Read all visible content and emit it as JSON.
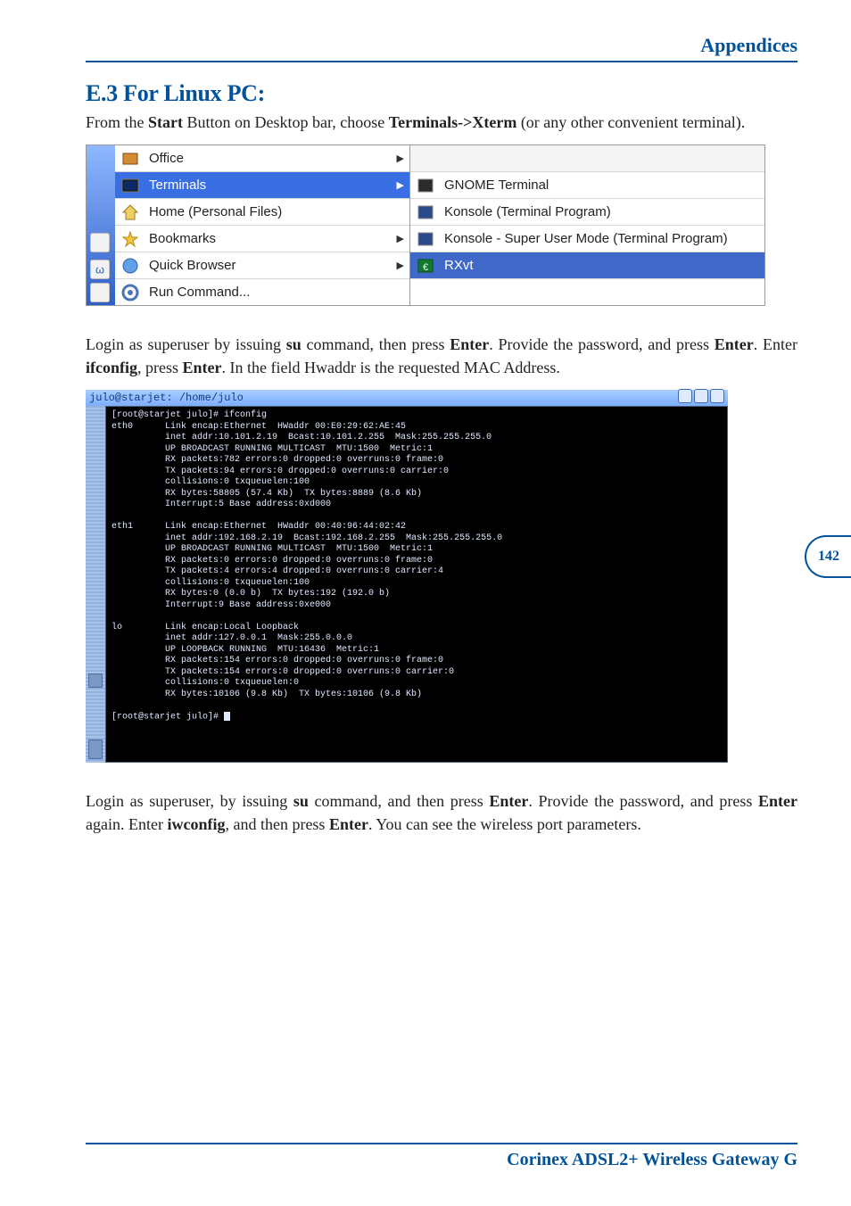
{
  "header": {
    "section": "Appendices"
  },
  "subsection": {
    "title": "E.3 For Linux PC:"
  },
  "intro": {
    "pre": "From the ",
    "b1": "Start",
    "mid1": " Button on Desktop bar, choose ",
    "b2": "Terminals->Xterm",
    "post": " (or any other convenient terminal)."
  },
  "menu": {
    "left": [
      {
        "label": "Office",
        "icon": "office-icon",
        "arrow": true
      },
      {
        "label": "Terminals",
        "icon": "terminal-icon",
        "arrow": true,
        "selected": true
      },
      {
        "label": "Home (Personal Files)",
        "icon": "home-icon",
        "arrow": false
      },
      {
        "label": "Bookmarks",
        "icon": "bookmark-icon",
        "arrow": true
      },
      {
        "label": "Quick Browser",
        "icon": "browser-icon",
        "arrow": true
      },
      {
        "label": "Run Command...",
        "icon": "run-icon",
        "arrow": false
      }
    ],
    "right": [
      {
        "label": "GNOME Terminal",
        "icon": "gnome-terminal-icon"
      },
      {
        "label": "Konsole (Terminal Program)",
        "icon": "konsole-icon"
      },
      {
        "label": "Konsole - Super User Mode (Terminal Program)",
        "icon": "konsole-su-icon"
      },
      {
        "label": "RXvt",
        "icon": "rxvt-icon",
        "selected": true
      }
    ]
  },
  "para2": {
    "t1": "Login as superuser by issuing ",
    "b_su": "su",
    "t2": " command, then press ",
    "b_enter1": "Enter",
    "t3": ". Provide the password, and press ",
    "b_enter2": "Enter",
    "t4": ". Enter ",
    "b_ifconfig": "ifconfig",
    "t5": ", press ",
    "b_enter3": "Enter",
    "t6": ". In the field Hwaddr is the requested MAC Address."
  },
  "terminal": {
    "title": "julo@starjet: /home/julo",
    "lines": "[root@starjet julo]# ifconfig\neth0      Link encap:Ethernet  HWaddr 00:E0:29:62:AE:45\n          inet addr:10.101.2.19  Bcast:10.101.2.255  Mask:255.255.255.0\n          UP BROADCAST RUNNING MULTICAST  MTU:1500  Metric:1\n          RX packets:782 errors:0 dropped:0 overruns:0 frame:0\n          TX packets:94 errors:0 dropped:0 overruns:0 carrier:0\n          collisions:0 txqueuelen:100\n          RX bytes:58805 (57.4 Kb)  TX bytes:8889 (8.6 Kb)\n          Interrupt:5 Base address:0xd000\n\neth1      Link encap:Ethernet  HWaddr 00:40:96:44:02:42\n          inet addr:192.168.2.19  Bcast:192.168.2.255  Mask:255.255.255.0\n          UP BROADCAST RUNNING MULTICAST  MTU:1500  Metric:1\n          RX packets:0 errors:0 dropped:0 overruns:0 frame:0\n          TX packets:4 errors:4 dropped:0 overruns:0 carrier:4\n          collisions:0 txqueuelen:100\n          RX bytes:0 (0.0 b)  TX bytes:192 (192.0 b)\n          Interrupt:9 Base address:0xe000\n\nlo        Link encap:Local Loopback\n          inet addr:127.0.0.1  Mask:255.0.0.0\n          UP LOOPBACK RUNNING  MTU:16436  Metric:1\n          RX packets:154 errors:0 dropped:0 overruns:0 frame:0\n          TX packets:154 errors:0 dropped:0 overruns:0 carrier:0\n          collisions:0 txqueuelen:0\n          RX bytes:10106 (9.8 Kb)  TX bytes:10106 (9.8 Kb)\n\n[root@starjet julo]# "
  },
  "para3": {
    "t1": "Login as superuser, by issuing ",
    "b_su": "su",
    "t2": " command, and then press ",
    "b_enter1": "Enter",
    "t3": ". Provide the password, and press ",
    "b_enter2": "Enter",
    "t4": " again. Enter ",
    "b_iwconfig": "iwconfig",
    "t5": ", and then press ",
    "b_enter3": "Enter",
    "t6": ". You can see the wireless port parameters."
  },
  "page_number": "142",
  "footer": {
    "text": "Corinex ADSL2+ Wireless Gateway G"
  }
}
